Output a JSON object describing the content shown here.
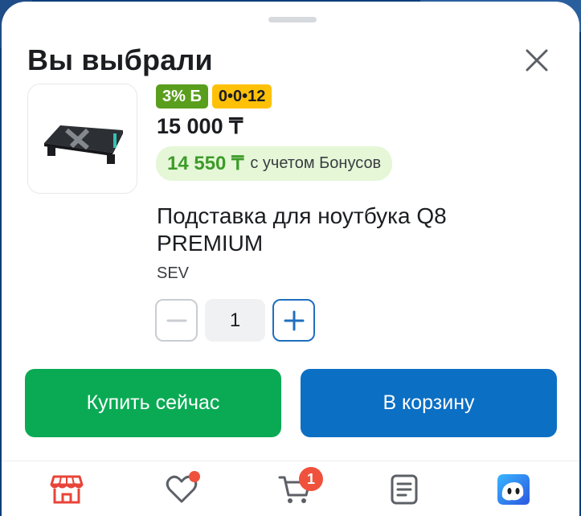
{
  "sheet": {
    "title": "Вы выбрали",
    "close_icon": "close-icon"
  },
  "product": {
    "image_icon": "laptop-stand-image",
    "bonus_badge": "3% Б",
    "installment_badge": "0•0•12",
    "price": "15 000 ₸",
    "bonus_price": "14 550 ₸",
    "bonus_price_note": "с учетом Бонусов",
    "name": "Подставка для ноутбука Q8 PREMIUM",
    "brand": "SEV"
  },
  "quantity": {
    "value": "1",
    "minus_icon": "minus-icon",
    "plus_icon": "plus-icon"
  },
  "actions": {
    "buy_now": "Купить сейчас",
    "add_to_cart": "В корзину"
  },
  "tabbar": {
    "items": [
      {
        "icon": "store-icon"
      },
      {
        "icon": "heart-icon",
        "has_dot": true
      },
      {
        "icon": "cart-icon",
        "count": "1"
      },
      {
        "icon": "orders-icon"
      },
      {
        "icon": "assistant-icon"
      }
    ]
  },
  "colors": {
    "buy_button": "#0aaa54",
    "cart_button": "#0b6fc4",
    "bonus_badge": "#5a9e1e",
    "installment_badge": "#ffc107",
    "notification": "#f0513c"
  }
}
